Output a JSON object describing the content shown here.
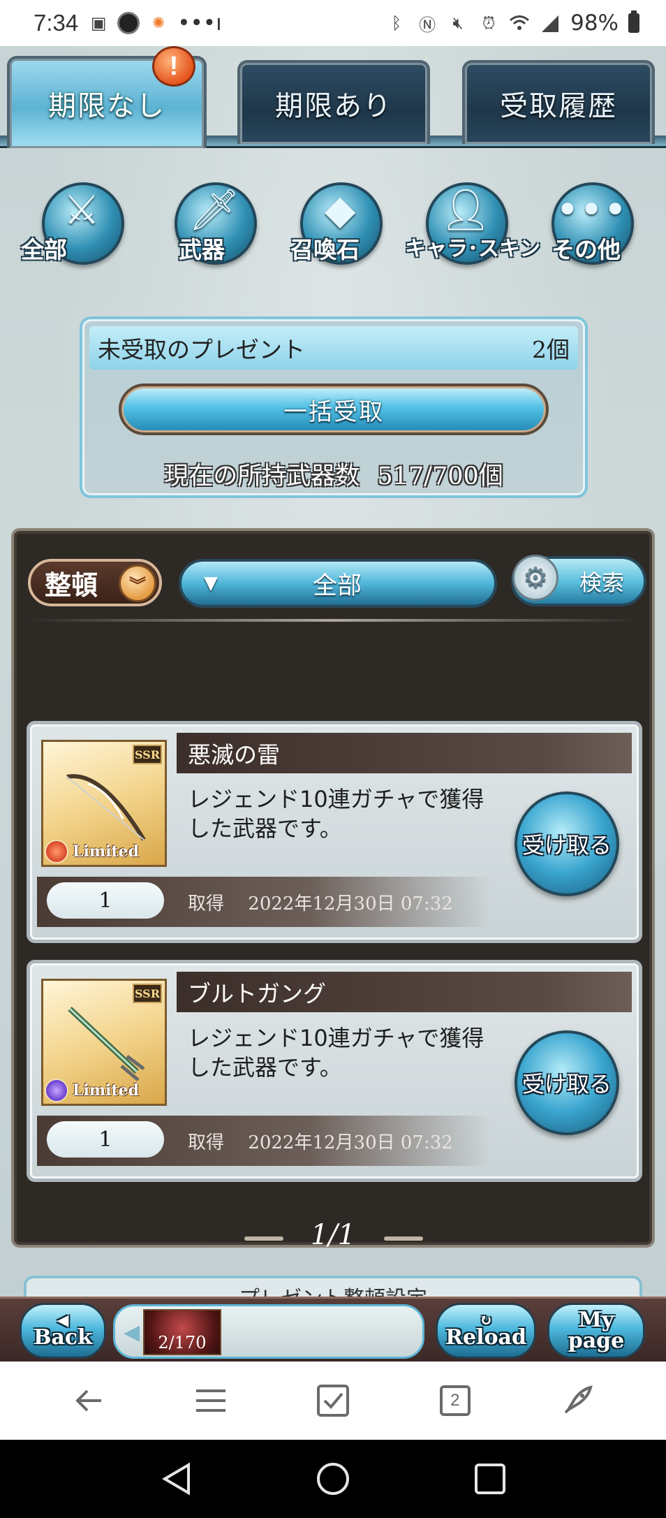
{
  "status_bar": {
    "time": "7:34",
    "dots": "•••ı",
    "battery": "98%"
  },
  "tabs": [
    {
      "label": "期限なし",
      "active": true
    },
    {
      "label": "期限あり",
      "active": false
    },
    {
      "label": "受取履歴",
      "active": false
    }
  ],
  "tab_badge": "!",
  "categories": [
    {
      "label": "全部",
      "icon": "all-icon"
    },
    {
      "label": "武器",
      "icon": "sword-icon"
    },
    {
      "label": "召喚石",
      "icon": "crystal-icon"
    },
    {
      "label": "キャラ･スキン",
      "icon": "character-icon"
    },
    {
      "label": "その他",
      "icon": "more-icon"
    }
  ],
  "present": {
    "header": "未受取のプレゼント",
    "count": "2個",
    "bulk_button": "一括受取",
    "weapon_count_label": "現在の所持武器数",
    "weapon_count_value": "517/700個"
  },
  "list": {
    "sort_label": "整頓",
    "filter_value": "全部",
    "search_label": "検索",
    "items": [
      {
        "name": "悪滅の雷",
        "rarity": "SSR",
        "tag": "Limited",
        "element_color": "#d8452a",
        "description": "レジェンド10連ガチャで獲得した武器です。",
        "quantity": "1",
        "acquired_label": "取得",
        "acquired_date": "2022年12月30日 07:32",
        "receive_label": "受け取る"
      },
      {
        "name": "ブルトガング",
        "rarity": "SSR",
        "tag": "Limited",
        "element_color": "#6a3fd1",
        "description": "レジェンド10連ガチャで獲得した武器です。",
        "quantity": "1",
        "acquired_label": "取得",
        "acquired_date": "2022年12月30日 07:32",
        "receive_label": "受け取る"
      }
    ],
    "pager": "1/1"
  },
  "settings_peek": "プレゼント整頓設定",
  "game_nav": {
    "back": "Back",
    "stamina": "2/170",
    "reload": "Reload",
    "my": "My",
    "page": "page"
  },
  "browser": {
    "tab_count": "2"
  },
  "colors": {
    "accent": "#4fb6da",
    "panel_dark": "#2d2925",
    "background": "#c7d3d4"
  }
}
